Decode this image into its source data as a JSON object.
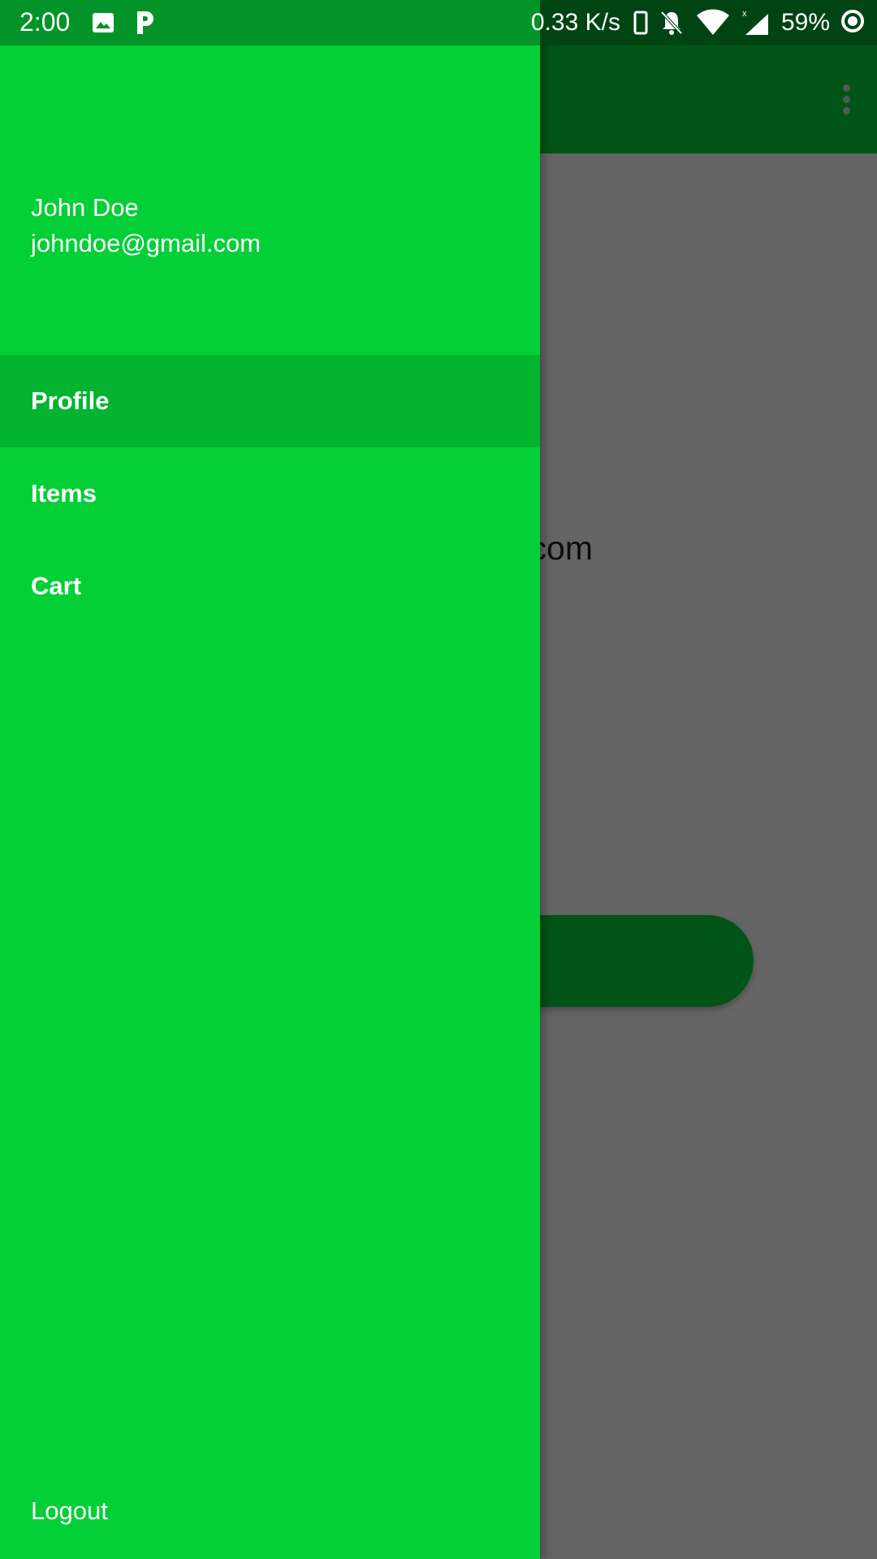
{
  "status_bar": {
    "time": "2:00",
    "network_speed": "0.33 K/s",
    "battery_percent": "59%",
    "icons": [
      "gallery-icon",
      "p-notification-icon",
      "phone-icon",
      "bell-off-icon",
      "wifi-icon",
      "signal-icon",
      "battery-ring-icon"
    ]
  },
  "background_screen": {
    "visible_text": "com",
    "menu_icon": "overflow-menu-icon"
  },
  "drawer": {
    "user_name": "John Doe",
    "user_email": "johndoe@gmail.com",
    "items": [
      {
        "label": "Profile",
        "selected": true
      },
      {
        "label": "Items",
        "selected": false
      },
      {
        "label": "Cart",
        "selected": false
      }
    ],
    "logout_label": "Logout"
  },
  "colors": {
    "drawer_bg": "#03d037",
    "drawer_selected": "#04b431",
    "toolbar": "#005417",
    "scrim": "#656565",
    "status_bar": "#029429"
  }
}
